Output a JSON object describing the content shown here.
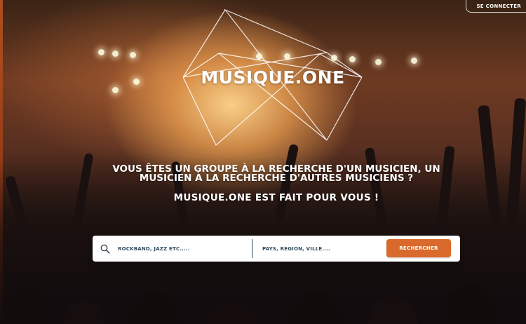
{
  "header": {
    "login_label": "SE CONNECTER"
  },
  "hero": {
    "brand": "MUSIQUE.ONE",
    "headline_line1": "VOUS ÊTES UN GROUPE À LA RECHERCHE D'UN MUSICIEN, UN",
    "headline_line2": "MUSICIEN À LA RECHERCHE D'AUTRES MUSICIENS ?",
    "tagline": "MUSIQUE.ONE EST FAIT POUR VOUS !"
  },
  "search": {
    "icon": "search-icon",
    "keyword_placeholder": "ROCKBAND, JAZZ ETC.....",
    "location_placeholder": "PAYS, RÉGION, VILLE....",
    "button_label": "RECHERCHER"
  },
  "colors": {
    "accent": "#d96a2b",
    "text_dark": "#2f4a5c"
  }
}
